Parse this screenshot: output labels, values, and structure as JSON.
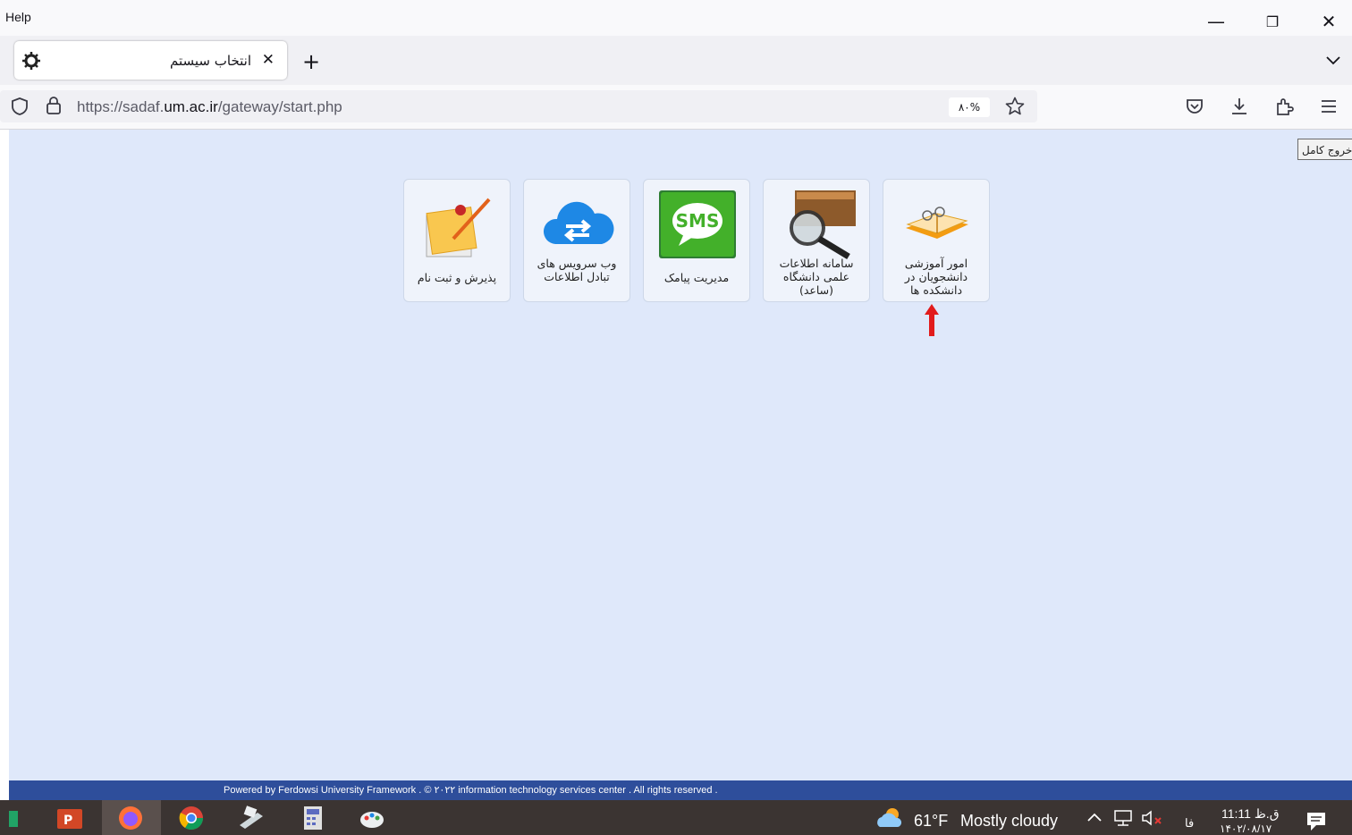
{
  "menubar": {
    "help_label": "Help"
  },
  "window_controls": {
    "minimize": "—",
    "restore": "❐",
    "close": "✕"
  },
  "tab": {
    "title": "انتخاب سیستم",
    "close": "✕"
  },
  "newtab": "+",
  "address": {
    "url_prefix": "https://sadaf.",
    "url_domain": "um.ac.ir",
    "url_path": "/gateway/start.php",
    "zoom": "۸۰%"
  },
  "page": {
    "exit_button": "خروج کامل",
    "tiles": [
      {
        "label": "امور آموزشی دانشجویان در دانشکده ها",
        "icon": "open-book-icon"
      },
      {
        "label": "سامانه اطلاعات علمی دانشگاه (ساعد)",
        "icon": "magnifier-book-icon"
      },
      {
        "label": "مدیریت پیامک",
        "icon": "sms-icon"
      },
      {
        "label": "وب سرویس های تبادل اطلاعات",
        "icon": "cloud-exchange-icon"
      },
      {
        "label": "پذیرش و ثبت نام",
        "icon": "registration-note-icon"
      }
    ],
    "footer": "Powered by Ferdowsi University Framework . © ۲۰۲۲ information technology services center . All rights reserved ."
  },
  "taskbar": {
    "temperature": "61°F",
    "weather": "Mostly cloudy",
    "language": "فا",
    "time": "11:11 ق.ظ",
    "date": "۱۴۰۲/۰۸/۱۷"
  },
  "colors": {
    "content_bg": "#dfe8fa",
    "footer_bg": "#2e4e9b",
    "taskbar_bg": "#3b3432",
    "arrow": "#e21b1b"
  }
}
